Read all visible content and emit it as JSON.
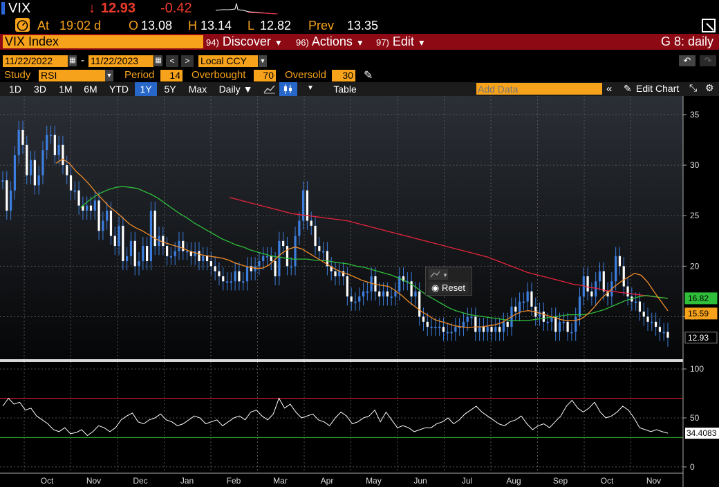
{
  "header": {
    "ticker": "VIX",
    "arrow": "↓",
    "last": "12.93",
    "change": "-0.42",
    "at_label": "At",
    "time": "19:02 d",
    "open_label": "O",
    "open": "13.08",
    "high_label": "H",
    "high": "13.14",
    "low_label": "L",
    "low": "12.82",
    "prev_label": "Prev",
    "prev": "13.35"
  },
  "menubar": {
    "security": "VIX Index",
    "discover_num": "94)",
    "discover": "Discover",
    "actions_num": "96)",
    "actions": "Actions",
    "edit_num": "97)",
    "edit": "Edit",
    "title": "G 8: daily"
  },
  "controls": {
    "start_date": "11/22/2022",
    "dash": "-",
    "end_date": "11/22/2023",
    "currency": "Local CCY"
  },
  "study": {
    "study_label": "Study",
    "study_value": "RSI",
    "period_label": "Period",
    "period_value": "14",
    "overbought_label": "Overbought",
    "overbought_value": "70",
    "oversold_label": "Oversold",
    "oversold_value": "30"
  },
  "toolbar": {
    "ranges": [
      "1D",
      "3D",
      "1M",
      "6M",
      "YTD",
      "1Y",
      "5Y",
      "Max"
    ],
    "selected_range": "1Y",
    "frequency": "Daily ▼",
    "table": "Table",
    "add_data_placeholder": "Add Data",
    "edit_chart": "Edit Chart"
  },
  "colors": {
    "price": "#3d7fe0",
    "ma_short": "#f08c2a",
    "ma_mid": "#2fbf3a",
    "ma_long": "#e8243c",
    "rsi": "#ffffff",
    "overbought": "#e0202a",
    "oversold": "#33bb33"
  },
  "reset_popup": {
    "label": "Reset"
  },
  "chart_data": [
    {
      "type": "line",
      "series_type": "candlestick",
      "title": "",
      "x": [
        "Oct",
        "Nov",
        "Dec",
        "Jan",
        "Feb",
        "Mar",
        "Apr",
        "May",
        "Jun",
        "Jul",
        "Aug",
        "Sep",
        "Oct",
        "Nov"
      ],
      "ylim": [
        11,
        36.5
      ],
      "yticks": [
        15,
        20,
        25,
        30,
        35
      ],
      "price": [
        28.5,
        25.5,
        27.5,
        31,
        33.5,
        32,
        29,
        30.5,
        28,
        29,
        31.5,
        33,
        33,
        31,
        32,
        30,
        29,
        27.5,
        27.5,
        26,
        25.5,
        26,
        25.5,
        26.5,
        23.5,
        24.5,
        25.5,
        23,
        22,
        24,
        20.5,
        21,
        22.5,
        20,
        20.5,
        22,
        20.5,
        25.5,
        22,
        23,
        22,
        21,
        21,
        21.5,
        22.5,
        21.5,
        21.5,
        21,
        21.5,
        20.5,
        21,
        20.5,
        20,
        19.5,
        19,
        18.5,
        18.5,
        18.5,
        19.5,
        18.5,
        18.5,
        20,
        19.5,
        20,
        20.5,
        21,
        21,
        20.5,
        19,
        22.5,
        22,
        20,
        20,
        23,
        24.5,
        27.5,
        24.5,
        24,
        22,
        21.5,
        21.5,
        20,
        19.5,
        19,
        19.5,
        19,
        17,
        16.5,
        16.5,
        17,
        17.5,
        17.5,
        19,
        17.5,
        17,
        17.5,
        17,
        17,
        17.5,
        19,
        18.5,
        18.5,
        17,
        17.5,
        15,
        14.5,
        14,
        14,
        14,
        14,
        13.5,
        13.5,
        13.5,
        14,
        14,
        14.5,
        15,
        15,
        13.5,
        14,
        13.5,
        14,
        13.5,
        14,
        13.5,
        14.5,
        14,
        16,
        15.5,
        16.5,
        16.5,
        17.5,
        16,
        15,
        15.5,
        14.5,
        14.5,
        15,
        13.5,
        14.5,
        14.5,
        13.5,
        13.5,
        15,
        17,
        19,
        17.5,
        17,
        18.5,
        19.5,
        17.5,
        17,
        18.5,
        21,
        20,
        18,
        17,
        16.5,
        16.5,
        15.5,
        15,
        14.5,
        14.5,
        14,
        13.5,
        13.5,
        12.93
      ],
      "ma_short": [
        null,
        null,
        null,
        null,
        null,
        null,
        null,
        null,
        30.2,
        30.6,
        30.2,
        29.4,
        28.8,
        28.1,
        27.3,
        26.6,
        25.9,
        25.4,
        24.8,
        24.2,
        23.8,
        23.5,
        23.1,
        22.7,
        22.4,
        22.2,
        22.0,
        21.8,
        21.5,
        21.3,
        21.1,
        21.0,
        20.9,
        20.8,
        20.6,
        20.3,
        20.1,
        19.9,
        19.8,
        19.8,
        20.1,
        20.7,
        21.3,
        21.7,
        21.9,
        21.7,
        21.3,
        20.9,
        20.5,
        20.1,
        19.7,
        19.4,
        19.2,
        18.9,
        18.6,
        18.4,
        18.2,
        18.1,
        18.0,
        17.6,
        17.1,
        16.5,
        16.0,
        15.5,
        15.1,
        14.7,
        14.5,
        14.3,
        14.1,
        14.0,
        13.9,
        14.0,
        14.0,
        14.1,
        14.2,
        14.4,
        14.8,
        15.2,
        15.5,
        15.6,
        15.5,
        15.3,
        15.1,
        14.9,
        14.7,
        14.6,
        14.6,
        14.8,
        15.3,
        16.0,
        16.8,
        17.4,
        18.0,
        18.5,
        18.9,
        19.3,
        19.1,
        18.4,
        17.4,
        16.5,
        15.59
      ],
      "ma_mid": [
        null,
        null,
        null,
        null,
        null,
        null,
        null,
        null,
        null,
        null,
        null,
        25.8,
        26.4,
        26.9,
        27.3,
        27.6,
        27.8,
        27.9,
        27.8,
        27.7,
        27.4,
        27.1,
        26.7,
        26.2,
        25.7,
        25.2,
        24.8,
        24.3,
        23.9,
        23.5,
        23.1,
        22.7,
        22.4,
        22.1,
        21.9,
        21.6,
        21.4,
        21.2,
        21.0,
        20.9,
        20.8,
        20.7,
        20.7,
        20.7,
        20.6,
        20.6,
        20.5,
        20.4,
        20.3,
        20.2,
        20.0,
        19.9,
        19.7,
        19.5,
        19.3,
        19.1,
        18.8,
        18.5,
        18.1,
        17.6,
        17.1,
        16.7,
        16.3,
        15.9,
        15.6,
        15.4,
        15.2,
        15.1,
        15.0,
        14.9,
        14.8,
        14.7,
        14.6,
        14.6,
        14.6,
        14.7,
        14.8,
        14.9,
        15.0,
        15.1,
        15.2,
        15.2,
        15.2,
        15.3,
        15.5,
        15.7,
        16.0,
        16.3,
        16.6,
        16.8,
        17.0,
        17.1,
        17.0,
        16.9,
        16.82
      ],
      "ma_long": [
        null,
        null,
        null,
        null,
        null,
        null,
        null,
        null,
        null,
        null,
        null,
        null,
        null,
        null,
        null,
        null,
        null,
        null,
        null,
        null,
        null,
        null,
        null,
        null,
        null,
        null,
        null,
        null,
        null,
        26.8,
        26.6,
        26.4,
        26.2,
        26.0,
        25.8,
        25.6,
        25.4,
        25.2,
        25.1,
        25.0,
        24.9,
        24.8,
        24.7,
        24.6,
        24.5,
        24.3,
        24.1,
        23.9,
        23.7,
        23.5,
        23.3,
        23.1,
        22.9,
        22.7,
        22.5,
        22.3,
        22.1,
        21.9,
        21.7,
        21.5,
        21.3,
        21.1,
        20.9,
        20.6,
        20.3,
        20.0,
        19.7,
        19.4,
        19.2,
        19.0,
        18.8,
        18.6,
        18.4,
        18.2,
        18.1,
        17.9,
        17.8,
        17.6,
        17.5,
        17.4,
        17.3,
        17.2,
        17.1,
        17.0,
        16.9,
        16.82
      ],
      "last_labels": [
        "16.82",
        "15.59",
        "12.93"
      ]
    },
    {
      "type": "line",
      "title": "",
      "x": [
        "Oct",
        "Nov",
        "Dec",
        "Jan",
        "Feb",
        "Mar",
        "Apr",
        "May",
        "Jun",
        "Jul",
        "Aug",
        "Sep",
        "Oct",
        "Nov"
      ],
      "ylim": [
        -5,
        105
      ],
      "yticks": [
        0,
        50,
        100
      ],
      "overbought": 70,
      "oversold": 30,
      "rsi": [
        62,
        70,
        64,
        66,
        58,
        60,
        52,
        48,
        44,
        38,
        36,
        40,
        34,
        35,
        38,
        32,
        36,
        42,
        40,
        36,
        40,
        48,
        52,
        55,
        46,
        44,
        48,
        50,
        54,
        48,
        46,
        42,
        44,
        48,
        52,
        50,
        44,
        46,
        48,
        42,
        46,
        50,
        52,
        48,
        56,
        58,
        52,
        48,
        54,
        70,
        60,
        64,
        56,
        50,
        52,
        54,
        48,
        46,
        42,
        50,
        56,
        52,
        44,
        46,
        50,
        52,
        58,
        46,
        56,
        48,
        40,
        42,
        40,
        36,
        38,
        40,
        40,
        44,
        46,
        50,
        44,
        48,
        54,
        58,
        62,
        56,
        52,
        48,
        44,
        42,
        46,
        48,
        52,
        44,
        38,
        42,
        44,
        40,
        46,
        52,
        62,
        68,
        60,
        56,
        60,
        66,
        56,
        50,
        52,
        56,
        62,
        58,
        50,
        40,
        38,
        36,
        38,
        36,
        34.4083
      ],
      "last_label": "34.4083"
    }
  ]
}
